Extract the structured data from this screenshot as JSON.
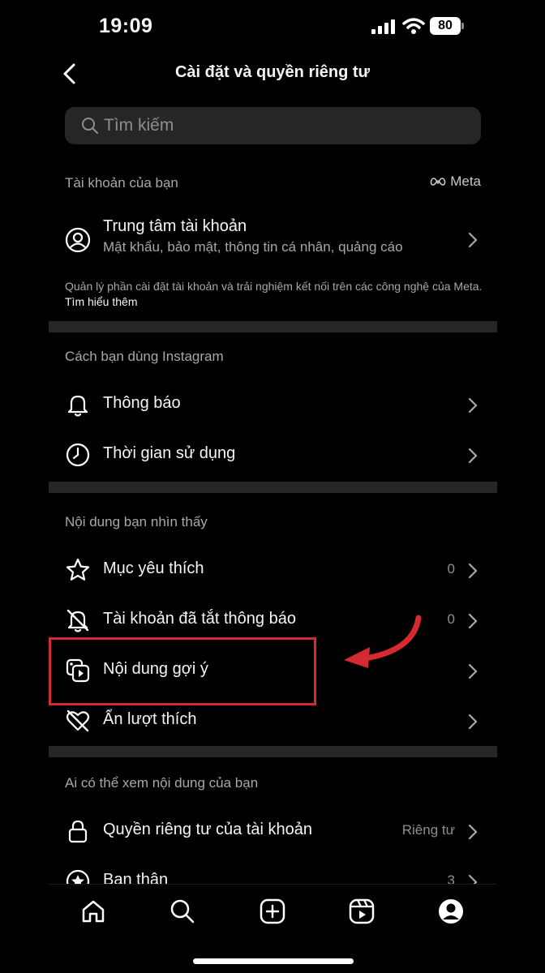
{
  "status_bar": {
    "time": "19:09",
    "battery": "80"
  },
  "header": {
    "title": "Cài đặt và quyền riêng tư"
  },
  "search": {
    "placeholder": "Tìm kiếm"
  },
  "sections": {
    "account": {
      "heading": "Tài khoản của bạn",
      "meta_label": "Meta",
      "account_center": {
        "title": "Trung tâm tài khoản",
        "subtitle": "Mật khẩu, bảo mật, thông tin cá nhân, quảng cáo"
      },
      "note": "Quản lý phần cài đặt tài khoản và trải nghiệm kết nối trên các công nghệ của Meta.",
      "note_link": "Tìm hiểu thêm"
    },
    "usage": {
      "heading": "Cách bạn dùng Instagram",
      "items": [
        {
          "label": "Thông báo",
          "icon": "bell-icon"
        },
        {
          "label": "Thời gian sử dụng",
          "icon": "clock-icon"
        }
      ]
    },
    "content_seen": {
      "heading": "Nội dung bạn nhìn thấy",
      "items": [
        {
          "label": "Mục yêu thích",
          "value": "0",
          "icon": "star-icon"
        },
        {
          "label": "Tài khoản đã tắt thông báo",
          "value": "0",
          "icon": "bell-muted-icon"
        },
        {
          "label": "Nội dung gợi ý",
          "icon": "suggested-content-icon"
        },
        {
          "label": "Ẩn lượt thích",
          "icon": "heart-hidden-icon"
        }
      ]
    },
    "who_sees": {
      "heading": "Ai có thể xem nội dung của bạn",
      "items": [
        {
          "label": "Quyền riêng tư của tài khoản",
          "value": "Riêng tư",
          "icon": "lock-icon"
        },
        {
          "label": "Bạn thân",
          "value": "3",
          "icon": "star-circle-icon"
        }
      ]
    }
  },
  "tab_bar": [
    "home-icon",
    "search-icon",
    "create-icon",
    "reels-icon",
    "profile-icon"
  ],
  "colors": {
    "background": "#000000",
    "highlight_box": "#d42a30",
    "divider": "#262626",
    "secondary_text": "#a8a8a8"
  }
}
